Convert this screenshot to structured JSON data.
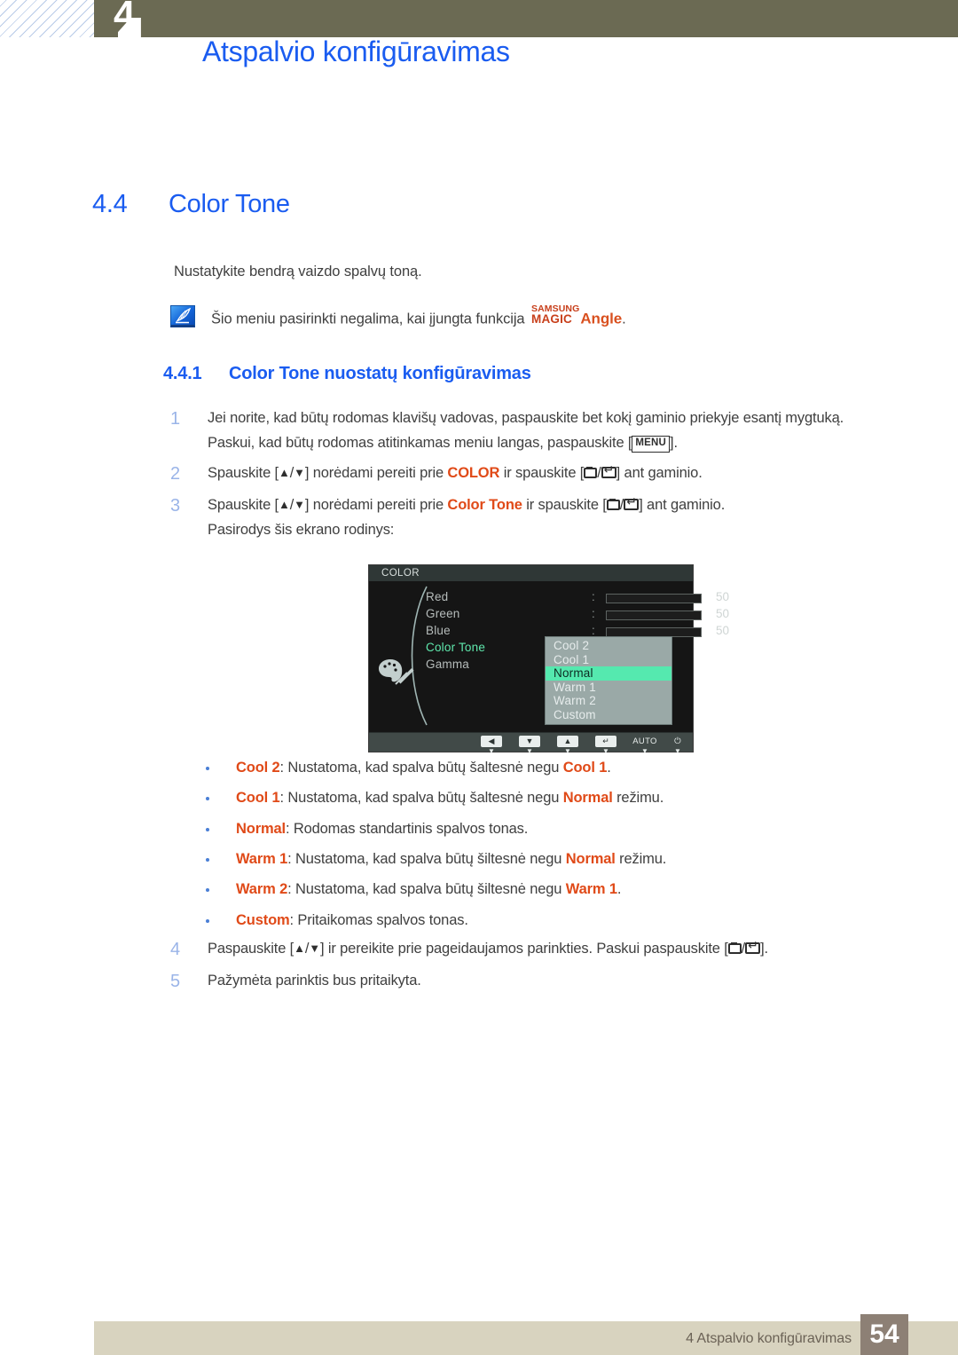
{
  "header": {
    "chapter_number": "4",
    "title": "Atspalvio konfigūravimas"
  },
  "section": {
    "number": "4.4",
    "title": "Color Tone",
    "intro": "Nustatykite bendrą vaizdo spalvų toną."
  },
  "note": {
    "icon": "note-quill-icon",
    "text_before": "Šio meniu pasirinkti negalima, kai įjungta funkcija",
    "magic_line1": "SAMSUNG",
    "magic_line2": "MAGIC",
    "magic_word": "Angle",
    "text_after": "."
  },
  "subsection": {
    "number": "4.4.1",
    "title": "Color Tone nuostatų konfigūravimas"
  },
  "steps": {
    "s1_num": "1",
    "s1_line1": "Jei norite, kad būtų rodomas klavišų vadovas, paspauskite bet kokį gaminio priekyje esantį mygtuką.",
    "s1_line2_a": "Paskui, kad būtų rodomas atitinkamas meniu langas, paspauskite [",
    "s1_key": "MENU",
    "s1_line2_b": "].",
    "s2_num": "2",
    "s2_a": "Spauskite [",
    "s2_b": "] norėdami pereiti prie ",
    "s2_bold": "COLOR",
    "s2_c": " ir spauskite [",
    "s2_d": "] ant gaminio.",
    "s3_num": "3",
    "s3_a": "Spauskite [",
    "s3_b": "] norėdami pereiti prie ",
    "s3_bold": "Color Tone",
    "s3_c": " ir spauskite [",
    "s3_d": "] ant gaminio.",
    "s3_line2": "Pasirodys šis ekrano rodinys:",
    "s4_num": "4",
    "s4_a": "Paspauskite [",
    "s4_b": "] ir pereikite prie pageidaujamos parinkties. Paskui paspauskite [",
    "s4_c": "].",
    "s5_num": "5",
    "s5_text": "Pažymėta parinktis bus pritaikyta."
  },
  "osd": {
    "title": "COLOR",
    "palette_icon": "palette-icon",
    "rows": [
      {
        "label": "Red",
        "colon": ":",
        "value": "50",
        "fill_percent": 50,
        "type": "slider",
        "green": false
      },
      {
        "label": "Green",
        "colon": ":",
        "value": "50",
        "fill_percent": 50,
        "type": "slider",
        "green": false
      },
      {
        "label": "Blue",
        "colon": ":",
        "value": "50",
        "fill_percent": 50,
        "type": "slider",
        "green": false
      },
      {
        "label": "Color Tone",
        "colon": ":",
        "value": "",
        "fill_percent": 0,
        "type": "dropdown",
        "green": true
      },
      {
        "label": "Gamma",
        "colon": ":",
        "value": "",
        "fill_percent": 0,
        "type": "none",
        "green": false
      }
    ],
    "dropdown": {
      "items": [
        "Cool 2",
        "Cool 1",
        "Normal",
        "Warm 1",
        "Warm 2",
        "Custom"
      ],
      "selected": "Normal",
      "selected_index": 2
    },
    "footer_buttons": [
      {
        "name": "left-arrow-button",
        "glyph": "◀",
        "kind": "box"
      },
      {
        "name": "down-arrow-button",
        "glyph": "▼",
        "kind": "box"
      },
      {
        "name": "up-arrow-button",
        "glyph": "▲",
        "kind": "box"
      },
      {
        "name": "enter-button",
        "glyph": "↵",
        "kind": "box"
      },
      {
        "name": "auto-button",
        "glyph": "AUTO",
        "kind": "text"
      },
      {
        "name": "power-button",
        "glyph": "⏻",
        "kind": "text"
      }
    ],
    "colors": {
      "panel_bg": "#151515",
      "title_bg": "#2f3736",
      "footer_bg": "#414a48",
      "dropdown_bg": "#9aa9a7",
      "highlight": "#55e9af",
      "label_green": "#5fe8ad",
      "slider_fill": "#a9bcbb"
    }
  },
  "bullets": [
    {
      "term": "Cool 2",
      "mid": ": Nustatoma, kad spalva būtų šaltesnė negu ",
      "ref": "Cool 1",
      "tail": "."
    },
    {
      "term": "Cool 1",
      "mid": ": Nustatoma, kad spalva būtų šaltesnė negu ",
      "ref": "Normal",
      "tail": " režimu."
    },
    {
      "term": "Normal",
      "mid": ": Rodomas standartinis spalvos tonas.",
      "ref": "",
      "tail": ""
    },
    {
      "term": "Warm 1",
      "mid": ": Nustatoma, kad spalva būtų šiltesnė negu ",
      "ref": "Normal",
      "tail": " režimu."
    },
    {
      "term": "Warm 2",
      "mid": ": Nustatoma, kad spalva būtų šiltesnė negu ",
      "ref": "Warm 1",
      "tail": "."
    },
    {
      "term": "Custom",
      "mid": ": Pritaikomas spalvos tonas.",
      "ref": "",
      "tail": ""
    }
  ],
  "footer": {
    "text": "4 Atspalvio konfigūravimas",
    "page": "54"
  },
  "colors": {
    "heading_blue": "#1a5cf0",
    "accent_orange": "#e04a18",
    "olive": "#6b6a53",
    "footer_bar": "#d8d3bf",
    "footer_page_bg": "#8d8075",
    "step_number": "#9ab4e8"
  }
}
